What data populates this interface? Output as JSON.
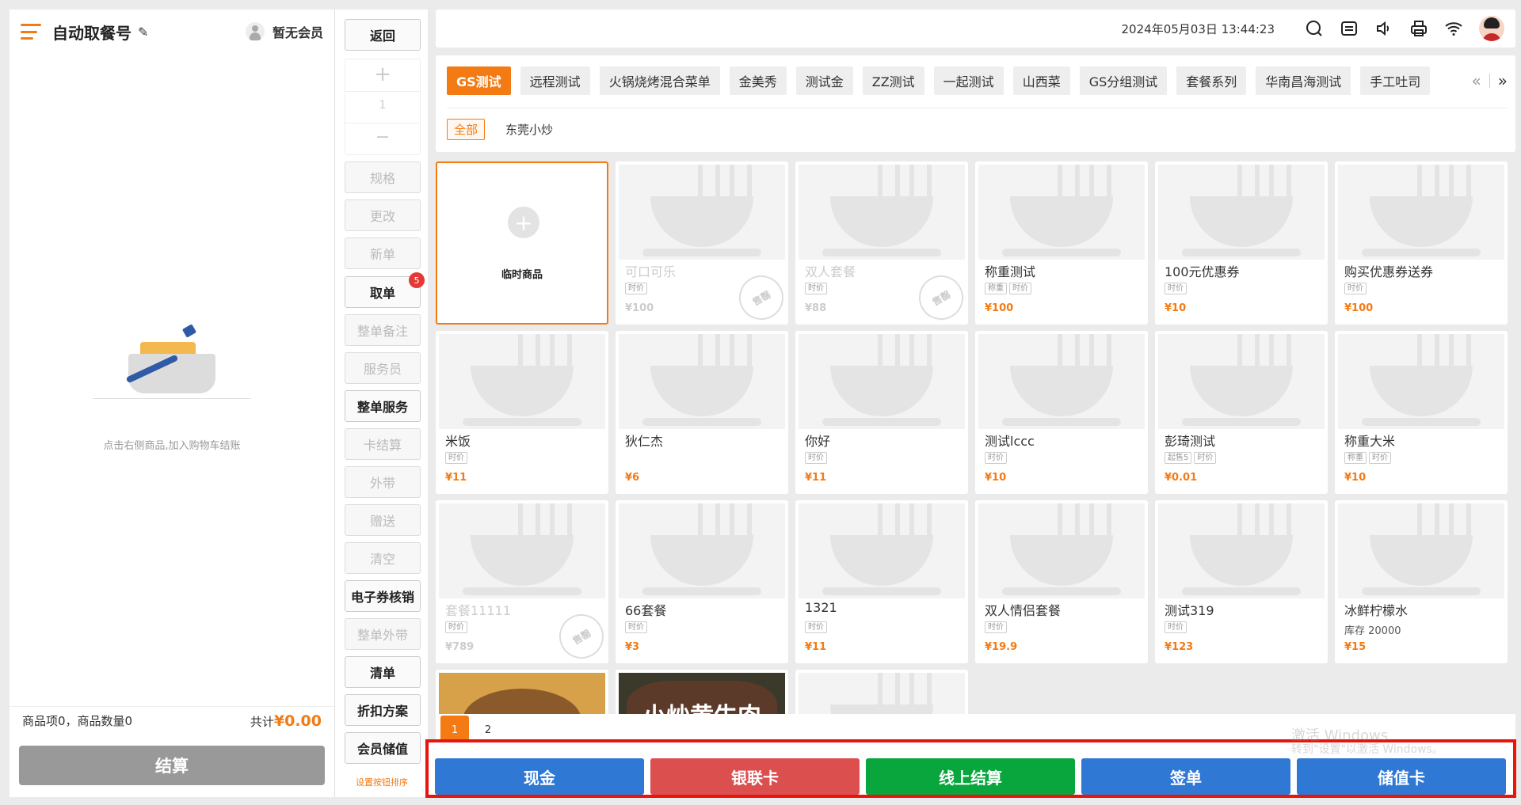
{
  "cart": {
    "title": "自动取餐号",
    "edit_icon": "✎",
    "member_label": "暂无会员",
    "empty_text": "点击右侧商品,加入购物车结账",
    "summary_label": "商品项0，商品数量0",
    "total_label": "共计",
    "total_amount": "¥0.00",
    "checkout_label": "结算"
  },
  "actions": {
    "back": "返回",
    "qty_plus": "+",
    "qty_value": "1",
    "qty_minus": "−",
    "spec": "规格",
    "modify": "更改",
    "new": "新单",
    "take": "取单",
    "take_badge": "5",
    "order_note": "整单备注",
    "waiter": "服务员",
    "order_service": "整单服务",
    "card_checkout": "卡结算",
    "takeout": "外带",
    "gift": "赠送",
    "clear": "清空",
    "ecoupon": "电子券核销",
    "order_takeout": "整单外带",
    "clear_order": "清单",
    "discount": "折扣方案",
    "member_deposit": "会员储值",
    "sort_link": "设置按钮排序"
  },
  "topbar": {
    "datetime": "2024年05月03日 13:44:23"
  },
  "categories": [
    "GS测试",
    "远程测试",
    "火锅烧烤混合菜单",
    "金美秀",
    "测试金",
    "ZZ测试",
    "一起测试",
    "山西菜",
    "GS分组测试",
    "套餐系列",
    "华南昌海测试",
    "手工吐司"
  ],
  "cat_nav": {
    "prev": "«",
    "next": "»"
  },
  "subcategories": [
    "全部",
    "东莞小炒"
  ],
  "temp_item": {
    "plus": "+",
    "label": "临时商品"
  },
  "products": [
    {
      "name": "可口可乐",
      "tags": [
        "时价"
      ],
      "price": "¥100",
      "sold": true,
      "stamp": "售罄"
    },
    {
      "name": "双人套餐",
      "tags": [
        "时价"
      ],
      "price": "¥88",
      "sold": true,
      "stamp": "售罄"
    },
    {
      "name": "称重测试",
      "tags": [
        "称重",
        "时价"
      ],
      "price": "¥100"
    },
    {
      "name": "100元优惠券",
      "tags": [
        "时价"
      ],
      "price": "¥10"
    },
    {
      "name": "购买优惠券送券",
      "tags": [
        "时价"
      ],
      "price": "¥100"
    },
    {
      "name": "米饭",
      "tags": [
        "时价"
      ],
      "price": "¥11"
    },
    {
      "name": "狄仁杰",
      "tags": [],
      "price": "¥6"
    },
    {
      "name": "你好",
      "tags": [
        "时价"
      ],
      "price": "¥11"
    },
    {
      "name": "测试lccc",
      "tags": [
        "时价"
      ],
      "price": "¥10"
    },
    {
      "name": "彭琦测试",
      "tags": [
        "起售5",
        "时价"
      ],
      "price": "¥0.01"
    },
    {
      "name": "称重大米",
      "tags": [
        "称重",
        "时价"
      ],
      "price": "¥10"
    },
    {
      "name": "套餐11111",
      "tags": [
        "时价"
      ],
      "price": "¥789",
      "sold": true,
      "stamp": "售罄"
    },
    {
      "name": "66套餐",
      "tags": [
        "时价"
      ],
      "price": "¥3"
    },
    {
      "name": "1321",
      "tags": [
        "时价"
      ],
      "price": "¥11"
    },
    {
      "name": "双人情侣套餐",
      "tags": [
        "时价"
      ],
      "price": "¥19.9"
    },
    {
      "name": "测试319",
      "tags": [
        "时价"
      ],
      "price": "¥123"
    },
    {
      "name": "冰鲜柠檬水",
      "tags": [],
      "stock": "库存  20000",
      "price": "¥15"
    }
  ],
  "food_overlay": "小炒黄牛肉",
  "pages": [
    "1",
    "2"
  ],
  "payments": [
    {
      "label": "现金",
      "color": "#2f78d4"
    },
    {
      "label": "银联卡",
      "color": "#db4f4f"
    },
    {
      "label": "线上结算",
      "color": "#08a63c"
    },
    {
      "label": "签单",
      "color": "#2f78d4"
    },
    {
      "label": "储值卡",
      "color": "#2f78d4"
    }
  ],
  "watermark": {
    "line1": "激活 Windows",
    "line2": "转到\"设置\"以激活 Windows。"
  },
  "colors": {
    "accent": "#f47a13",
    "highlight_border": "#e8150b"
  }
}
